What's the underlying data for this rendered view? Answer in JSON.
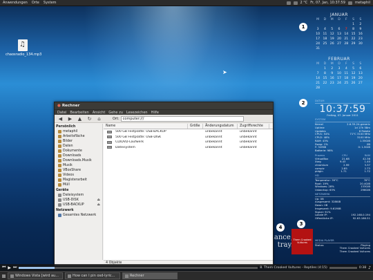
{
  "top_panel": {
    "menu": [
      "Anwendungen",
      "Orte",
      "System"
    ],
    "tray_text": "2 °C",
    "date_time": "Fr, 07. Jan, 10:37:59",
    "user": "metaphil"
  },
  "desktop_icon": {
    "label": "chaosradio_134.mp3"
  },
  "markers": [
    "1",
    "2",
    "3",
    "4"
  ],
  "calendar_jan": {
    "title": "JANUAR",
    "days": [
      "M",
      "D",
      "M",
      "D",
      "F",
      "S",
      "S"
    ],
    "dates": [
      "",
      "",
      "",
      "",
      "",
      "1",
      "2",
      "3",
      "4",
      "5",
      "6",
      "7",
      "8",
      "9",
      "10",
      "11",
      "12",
      "13",
      "14",
      "15",
      "16",
      "17",
      "18",
      "19",
      "20",
      "21",
      "22",
      "23",
      "24",
      "25",
      "26",
      "27",
      "28",
      "29",
      "30",
      "31",
      "",
      "",
      "",
      "",
      "",
      ""
    ],
    "today": "7"
  },
  "calendar_feb": {
    "title": "FEBRUAR",
    "days": [
      "M",
      "D",
      "M",
      "D",
      "F",
      "S",
      "S"
    ],
    "dates": [
      "",
      "1",
      "2",
      "3",
      "4",
      "5",
      "6",
      "7",
      "8",
      "9",
      "10",
      "11",
      "12",
      "13",
      "14",
      "15",
      "16",
      "17",
      "18",
      "19",
      "20",
      "21",
      "22",
      "23",
      "24",
      "25",
      "26",
      "27",
      "28",
      "",
      "",
      "",
      "",
      "",
      ""
    ]
  },
  "conky": {
    "datum_label": "DATUM",
    "clock": "10:37:59",
    "date": "Freitag, 07. Januar 2011",
    "system_label": "SYSTEM",
    "system_rows": [
      [
        "Kernel",
        "2.6.35-24-generic"
      ],
      [
        "Uptime",
        "1d 17h 58m"
      ],
      [
        "Updates",
        "8 Pakete"
      ],
      [
        "CPU1: 54%",
        "71°C  3100 MHz"
      ],
      [
        "CPU2: 48%",
        "3100 MHz"
      ],
      [
        "RAM: 43%",
        "1.35GiB"
      ],
      [
        "Swap: 1%",
        "0B"
      ],
      [
        "F: 32MiB",
        "0: 1.5GiB"
      ],
      [
        "Batterie: 98%",
        ""
      ]
    ],
    "process_header": [
      "Prozess",
      "CPU",
      "RAM"
    ],
    "processes": [
      [
        "VirtualBox",
        "21.68",
        "42.36"
      ],
      [
        "Xorg",
        "9.43",
        "1.40"
      ],
      [
        "chromium",
        "2.99",
        "3.37"
      ],
      [
        "compiz",
        "2.85",
        "2.73"
      ],
      [
        "pidgin",
        "1.71",
        "1.72"
      ]
    ],
    "hd_label": "HD",
    "hd_rows": [
      [
        "Temperatur: 39°C",
        "78°C"
      ],
      [
        "Root: 19%",
        "20.4GiB"
      ],
      [
        "Windows: 28%",
        "133GiB"
      ],
      [
        "Usbackup: 63%",
        "296GiB"
      ]
    ],
    "net_label": "NETZWERK",
    "net_rows": [
      [
        "Up: 0B",
        ""
      ],
      [
        "Ausgesamt: 328KiB",
        ""
      ],
      [
        "Down: 0B",
        ""
      ],
      [
        "Insgesamt: 9.61MiB",
        ""
      ],
      [
        "Signal: 91%",
        ""
      ],
      [
        "Lokale IP:",
        "192.168.0.194"
      ],
      [
        "Öffentliche IP:",
        "92.63.186.51"
      ]
    ]
  },
  "media": {
    "label": "MEDIA PLAYER",
    "rows": [
      [
        "Status:",
        "Playing"
      ],
      [
        "",
        "Them Crooked Vultures"
      ],
      [
        "",
        "Them Crooked Vultures"
      ]
    ],
    "album_text": "Them Crooked Vultures"
  },
  "monkey_text": [
    "Watch the monkey dance,",
    "tray."
  ],
  "file_manager": {
    "title": "Rechner",
    "menu": [
      "Datei",
      "Bearbeiten",
      "Ansicht",
      "Gehe zu",
      "Lesezeichen",
      "Hilfe"
    ],
    "location_label": "Ort:",
    "location_value": "computer:///",
    "sidebar": {
      "personal_header": "Persönlich",
      "personal": [
        "metaphil",
        "Arbeitsfläche",
        "Bilder",
        "Daten",
        "Dokumente",
        "Downloads",
        "Downloads.Musik",
        "Musik",
        "VBoxShare",
        "Videos",
        "Magisterarbeit",
        "Müll"
      ],
      "devices_header": "Geräte",
      "devices": [
        "Dateisystem",
        "USB-DISK",
        "USB-BACKUP"
      ],
      "network_header": "Netzwerk",
      "network": [
        "Gesamtes Netzwerk"
      ]
    },
    "columns": [
      "Name",
      "Größe",
      "Änderungsdatum",
      "Zugriffsrechte"
    ],
    "rows": [
      [
        "500 GB Festplatte: USB-BACKUP",
        "",
        "unbekannt",
        "unbekannt"
      ],
      [
        "500 GB Festplatte: USB-DISK",
        "",
        "unbekannt",
        "unbekannt"
      ],
      [
        "CD/DVD-Laufwerk",
        "",
        "unbekannt",
        "unbekannt"
      ],
      [
        "Dateisystem",
        "",
        "unbekannt",
        "unbekannt"
      ]
    ],
    "status": "4 Objekte"
  },
  "music_bar": {
    "track": "8. Them Crooked Vultures - Reptiles (4:15)",
    "time": "0:38",
    "progress": 0.15
  },
  "taskbar": [
    {
      "label": "Windows Vista [wird au...",
      "active": false
    },
    {
      "label": "How can I pin osd-lyric...",
      "active": false
    },
    {
      "label": "Rechner",
      "active": true
    }
  ],
  "colors": {
    "accent": "#9fc3ea",
    "album": "#b31212",
    "today": "#cc3333"
  }
}
